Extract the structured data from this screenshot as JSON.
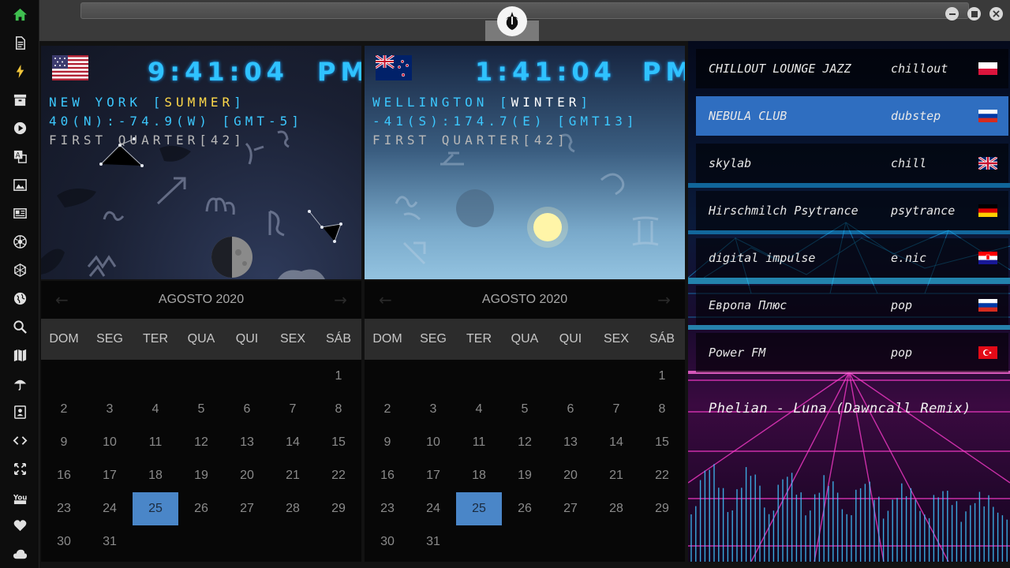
{
  "sidebar": {
    "items": [
      {
        "name": "home-icon",
        "color": "#3fbf4f"
      },
      {
        "name": "document-icon"
      },
      {
        "name": "lightning-icon",
        "color": "#f0c43a"
      },
      {
        "name": "archive-icon"
      },
      {
        "name": "play-icon"
      },
      {
        "name": "translate-icon"
      },
      {
        "name": "image-icon"
      },
      {
        "name": "news-icon"
      },
      {
        "name": "aperture-icon"
      },
      {
        "name": "hexagon-icon"
      },
      {
        "name": "globe-icon"
      },
      {
        "name": "search-icon"
      },
      {
        "name": "map-icon"
      },
      {
        "name": "umbrella-icon"
      },
      {
        "name": "contacts-icon"
      },
      {
        "name": "code-icon"
      },
      {
        "name": "expand-icon"
      },
      {
        "name": "youtube-icon"
      },
      {
        "name": "heart-icon"
      },
      {
        "name": "cloud-icon"
      }
    ]
  },
  "clocks": [
    {
      "time": "9:41:04",
      "ampm": "PM",
      "city": "NEW YORK [",
      "season": "SUMMER",
      "city_end": "]",
      "coords": "40(N):-74.9(W) [GMT-5]",
      "moon": "FIRST QUARTER[42]",
      "flag": "us-flag"
    },
    {
      "time": "1:41:04",
      "ampm": "PM",
      "city": "WELLINGTON [",
      "season": "WINTER",
      "city_end": "]",
      "coords": "-41(S):174.7(E) [GMT13]",
      "moon": "FIRST QUARTER[42]",
      "flag": "nz-flag"
    }
  ],
  "calendar": {
    "month": "AGOSTO 2020",
    "prev": "←",
    "next": "→",
    "days": [
      "DOM",
      "SEG",
      "TER",
      "QUA",
      "QUI",
      "SEX",
      "SÁB"
    ],
    "weeks": [
      [
        "",
        "",
        "",
        "",
        "",
        "",
        "1"
      ],
      [
        "2",
        "3",
        "4",
        "5",
        "6",
        "7",
        "8"
      ],
      [
        "9",
        "10",
        "11",
        "12",
        "13",
        "14",
        "15"
      ],
      [
        "16",
        "17",
        "18",
        "19",
        "20",
        "21",
        "22"
      ],
      [
        "23",
        "24",
        "25",
        "26",
        "27",
        "28",
        "29"
      ],
      [
        "30",
        "31",
        "",
        "",
        "",
        "",
        ""
      ]
    ],
    "today": "25"
  },
  "radio": {
    "stations": [
      {
        "name": "CHILLOUT LOUNGE JAZZ",
        "genre": "chillout",
        "flag": "poland-flag"
      },
      {
        "name": "NEBULA CLUB",
        "genre": "dubstep",
        "flag": "russia-flag",
        "active": true
      },
      {
        "name": "skylab",
        "genre": "chill",
        "flag": "uk-flag"
      },
      {
        "name": "Hirschmilch Psytrance",
        "genre": "psytrance",
        "flag": "germany-flag"
      },
      {
        "name": "digital impulse",
        "genre": "e.nic",
        "flag": "croatia-flag"
      },
      {
        "name": "Европа Плюс",
        "genre": "pop",
        "flag": "russia-flag"
      },
      {
        "name": "Power FM",
        "genre": "pop",
        "flag": "turkey-flag"
      }
    ],
    "now_playing": "Phelian - Luna (Dawncall Remix)"
  },
  "colors": {
    "accent": "#4a86c8",
    "clock_text": "#2fc2ff",
    "season_summer": "#ffd94a"
  }
}
